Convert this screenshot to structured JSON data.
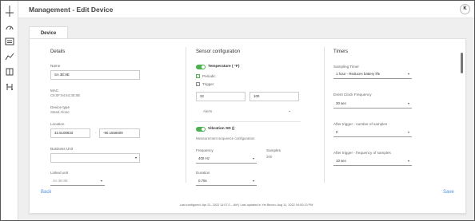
{
  "header": {
    "title": "Management - Edit Device",
    "avatar_initial": "K"
  },
  "sidebar": {
    "icons": [
      "dashboard-icon",
      "list-icon",
      "chart-line-icon",
      "building-icon",
      "network-icon"
    ]
  },
  "tabs": [
    {
      "label": "Device"
    }
  ],
  "details": {
    "title": "Details",
    "name_label": "Name",
    "name_value": "SA 3E:8E",
    "mac_label": "MAC",
    "mac_value": "C8:0F:94:64:3E:8E",
    "type_label": "Device type",
    "type_value": "Stand Alone",
    "location_label": "Location",
    "lat": "32.5108833",
    "lon": "-90.1556609",
    "sep": "-",
    "business_unit_label": "Business Unit",
    "business_unit_value": "",
    "linked_unit_label": "Linked unit",
    "linked_unit_value": "SA 3E:8E"
  },
  "sensor": {
    "title": "Sensor configuration",
    "temp_label": "Temperature ( °F)",
    "periodic_label": "Periodic",
    "trigger_label": "Trigger",
    "min_value": "32",
    "max_value": "100",
    "alerts_label": "Alerts",
    "vibration_label": "Vibration SD ()",
    "measurement_label": "Measurement sequence configuration",
    "frequency_label": "Frequency",
    "frequency_value": "400 Hz",
    "samples_label": "Samples",
    "samples_value": "300",
    "duration_label": "Duration",
    "duration_value": "0.75s"
  },
  "timers": {
    "title": "Timers",
    "sampling_label": "Sampling Timer",
    "sampling_value": "1 hour - Reduces battery life",
    "event_label": "Event Clock Frequency",
    "event_value": "30 sec",
    "after_samples_label": "After trigger - number of samples",
    "after_samples_value": "0",
    "after_freq_label": "After trigger - frequency of samples",
    "after_freq_value": "10 sec"
  },
  "actions": {
    "back": "Back",
    "save": "Save"
  },
  "footer": {
    "text": "Last configured: Apr 21, 2022 11:07:2... AM | Last updated in Yet Becon: Aug 11, 2022 04:00:13 PM"
  },
  "colors": {
    "accent": "#4caf50",
    "link": "#4a90d9"
  }
}
